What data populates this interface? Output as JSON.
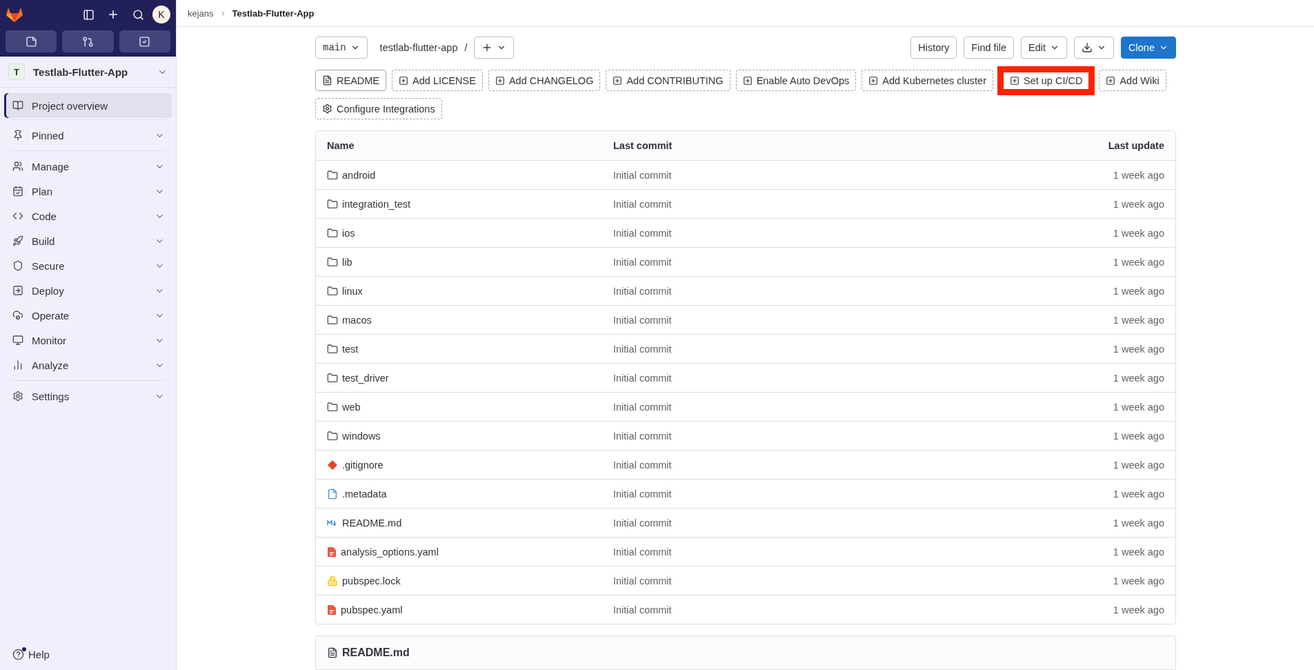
{
  "sidebar": {
    "avatar": "K",
    "project": {
      "initial": "T",
      "name": "Testlab-Flutter-App"
    },
    "nav_groups": [
      [
        {
          "label": "Project overview",
          "selected": true,
          "expandable": false
        }
      ],
      [
        {
          "label": "Pinned",
          "selected": false,
          "expandable": true
        }
      ],
      [
        {
          "label": "Manage",
          "selected": false,
          "expandable": true
        },
        {
          "label": "Plan",
          "selected": false,
          "expandable": true
        },
        {
          "label": "Code",
          "selected": false,
          "expandable": true
        },
        {
          "label": "Build",
          "selected": false,
          "expandable": true
        },
        {
          "label": "Secure",
          "selected": false,
          "expandable": true
        },
        {
          "label": "Deploy",
          "selected": false,
          "expandable": true
        },
        {
          "label": "Operate",
          "selected": false,
          "expandable": true
        },
        {
          "label": "Monitor",
          "selected": false,
          "expandable": true
        },
        {
          "label": "Analyze",
          "selected": false,
          "expandable": true
        }
      ],
      [
        {
          "label": "Settings",
          "selected": false,
          "expandable": true
        }
      ]
    ],
    "help": "Help"
  },
  "breadcrumb": [
    "kejans",
    "Testlab-Flutter-App"
  ],
  "repo_bar": {
    "branch": "main",
    "path": "testlab-flutter-app",
    "separator": "/",
    "buttons": [
      {
        "label": "History",
        "kind": "plain"
      },
      {
        "label": "Find file",
        "kind": "plain"
      },
      {
        "label": "Edit",
        "kind": "dropdown"
      },
      {
        "kind": "download"
      },
      {
        "label": "Clone",
        "kind": "primary"
      }
    ]
  },
  "actions": [
    {
      "label": "README",
      "kind": "readme",
      "highlighted": false
    },
    {
      "label": "Add LICENSE",
      "kind": "add",
      "highlighted": false
    },
    {
      "label": "Add CHANGELOG",
      "kind": "add",
      "highlighted": false
    },
    {
      "label": "Add CONTRIBUTING",
      "kind": "add",
      "highlighted": false
    },
    {
      "label": "Enable Auto DevOps",
      "kind": "add",
      "highlighted": false
    },
    {
      "label": "Add Kubernetes cluster",
      "kind": "add",
      "highlighted": false
    },
    {
      "label": "Set up CI/CD",
      "kind": "add",
      "highlighted": true
    },
    {
      "label": "Add Wiki",
      "kind": "add",
      "highlighted": false
    },
    {
      "label": "Configure Integrations",
      "kind": "settings",
      "highlighted": false
    }
  ],
  "table": {
    "columns": [
      "Name",
      "Last commit",
      "Last update"
    ],
    "rows": [
      {
        "name": "android",
        "kind": "folder",
        "commit": "Initial commit",
        "updated": "1 week ago"
      },
      {
        "name": "integration_test",
        "kind": "folder",
        "commit": "Initial commit",
        "updated": "1 week ago"
      },
      {
        "name": "ios",
        "kind": "folder",
        "commit": "Initial commit",
        "updated": "1 week ago"
      },
      {
        "name": "lib",
        "kind": "folder",
        "commit": "Initial commit",
        "updated": "1 week ago"
      },
      {
        "name": "linux",
        "kind": "folder",
        "commit": "Initial commit",
        "updated": "1 week ago"
      },
      {
        "name": "macos",
        "kind": "folder",
        "commit": "Initial commit",
        "updated": "1 week ago"
      },
      {
        "name": "test",
        "kind": "folder",
        "commit": "Initial commit",
        "updated": "1 week ago"
      },
      {
        "name": "test_driver",
        "kind": "folder",
        "commit": "Initial commit",
        "updated": "1 week ago"
      },
      {
        "name": "web",
        "kind": "folder",
        "commit": "Initial commit",
        "updated": "1 week ago"
      },
      {
        "name": "windows",
        "kind": "folder",
        "commit": "Initial commit",
        "updated": "1 week ago"
      },
      {
        "name": ".gitignore",
        "kind": "git",
        "commit": "Initial commit",
        "updated": "1 week ago"
      },
      {
        "name": ".metadata",
        "kind": "file",
        "commit": "Initial commit",
        "updated": "1 week ago"
      },
      {
        "name": "README.md",
        "kind": "markdown",
        "commit": "Initial commit",
        "updated": "1 week ago"
      },
      {
        "name": "analysis_options.yaml",
        "kind": "yaml",
        "commit": "Initial commit",
        "updated": "1 week ago"
      },
      {
        "name": "pubspec.lock",
        "kind": "lock",
        "commit": "Initial commit",
        "updated": "1 week ago"
      },
      {
        "name": "pubspec.yaml",
        "kind": "yaml",
        "commit": "Initial commit",
        "updated": "1 week ago"
      }
    ]
  },
  "readme": {
    "title": "README.md"
  }
}
